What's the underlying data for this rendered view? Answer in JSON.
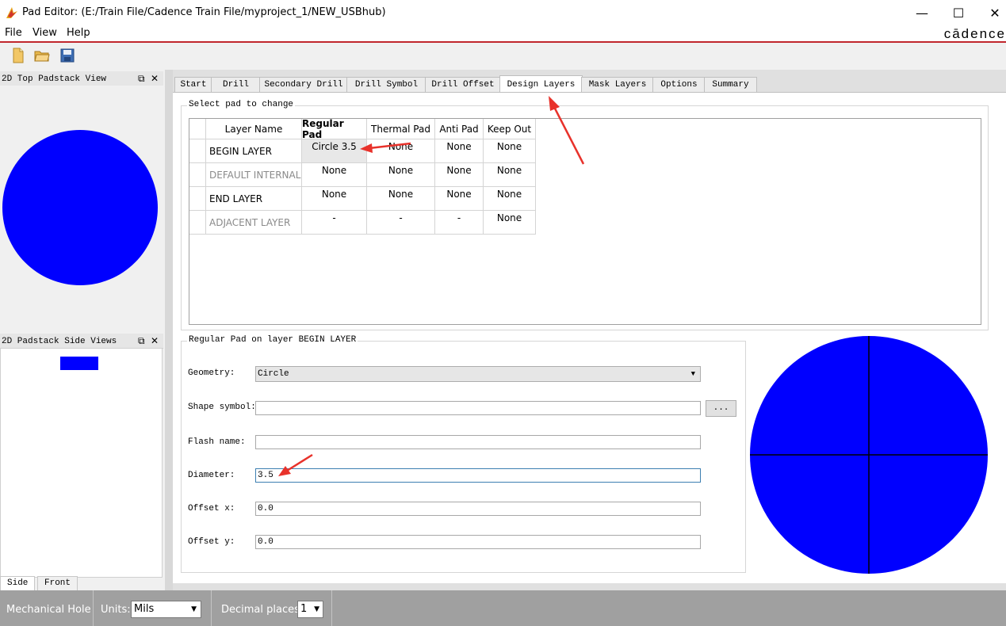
{
  "window": {
    "title": "Pad Editor:   (E:/Train File/Cadence Train File/myproject_1/NEW_USBhub)",
    "minimize": "—",
    "maximize": "☐",
    "close": "✕"
  },
  "menu": {
    "file": "File",
    "view": "View",
    "help": "Help",
    "brand": "cādence"
  },
  "toolbar": {
    "new_icon": "new-file-icon",
    "open_icon": "open-folder-icon",
    "save_icon": "save-disk-icon"
  },
  "docks": {
    "top_view_title": "2D Top Padstack View",
    "side_view_title": "2D Padstack Side Views",
    "float_btn": "⧉",
    "close_btn": "✕",
    "side_tabs": [
      "Side",
      "Front"
    ]
  },
  "tabs": [
    "Start",
    "Drill",
    "Secondary Drill",
    "Drill Symbol",
    "Drill Offset",
    "Design Layers",
    "Mask Layers",
    "Options",
    "Summary"
  ],
  "active_tab": "Design Layers",
  "select_group_label": "Select pad to change",
  "table": {
    "headers": [
      "Layer Name",
      "Regular Pad",
      "Thermal Pad",
      "Anti Pad",
      "Keep Out"
    ],
    "rows": [
      {
        "name": "BEGIN LAYER",
        "cells": [
          "Circle 3.5",
          "None",
          "None",
          "None"
        ]
      },
      {
        "name": "DEFAULT INTERNAL",
        "cells": [
          "None",
          "None",
          "None",
          "None"
        ]
      },
      {
        "name": "END LAYER",
        "cells": [
          "None",
          "None",
          "None",
          "None"
        ]
      },
      {
        "name": "ADJACENT LAYER",
        "cells": [
          "-",
          "-",
          "-",
          "None"
        ]
      }
    ]
  },
  "pad_group_label": "Regular Pad on layer BEGIN LAYER",
  "form": {
    "geometry_label": "Geometry:",
    "geometry_value": "Circle",
    "shape_symbol_label": "Shape symbol:",
    "shape_symbol_value": "",
    "browse_btn": "...",
    "flash_name_label": "Flash name:",
    "flash_name_value": "",
    "diameter_label": "Diameter:",
    "diameter_value": "3.5",
    "offset_x_label": "Offset x:",
    "offset_x_value": "0.0",
    "offset_y_label": "Offset y:",
    "offset_y_value": "0.0"
  },
  "status": {
    "mode": "Mechanical Hole",
    "units_label": "Units:",
    "units_value": "Mils",
    "decimal_label": "Decimal places:",
    "decimal_value": "1"
  },
  "colors": {
    "pad_fill": "#0000ff",
    "annotation_arrow": "#e8322b",
    "menu_rule": "#c0272d"
  }
}
